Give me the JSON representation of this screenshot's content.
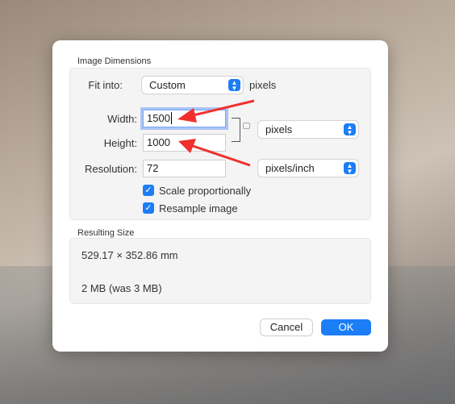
{
  "image_dimensions": {
    "title": "Image Dimensions",
    "fit_into_label": "Fit into:",
    "fit_into_value": "Custom",
    "fit_into_unit": "pixels",
    "width_label": "Width:",
    "width_value": "1500",
    "height_label": "Height:",
    "height_value": "1000",
    "size_unit": "pixels",
    "resolution_label": "Resolution:",
    "resolution_value": "72",
    "resolution_unit": "pixels/inch",
    "scale_proportionally": {
      "label": "Scale proportionally",
      "checked": true
    },
    "resample_image": {
      "label": "Resample image",
      "checked": true
    }
  },
  "resulting_size": {
    "title": "Resulting Size",
    "dimensions": "529.17 × 352.86 mm",
    "file_size": "2 MB (was 3 MB)"
  },
  "buttons": {
    "cancel": "Cancel",
    "ok": "OK"
  },
  "colors": {
    "accent": "#1b7ef6",
    "annotation_arrow": "#f0302c"
  }
}
